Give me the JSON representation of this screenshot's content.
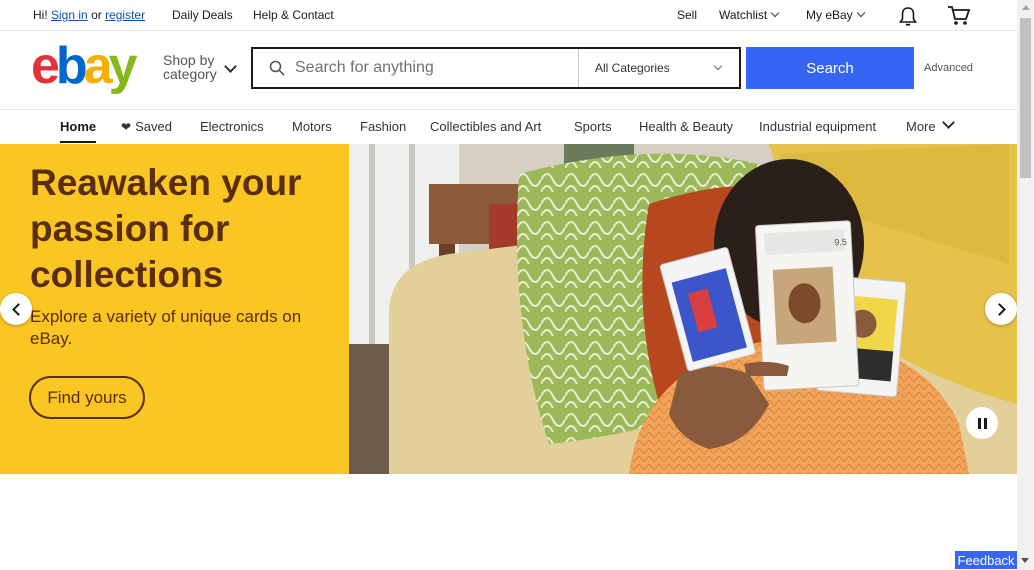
{
  "topbar": {
    "greeting": "Hi!",
    "sign_in": "Sign in",
    "or": "or",
    "register": "register",
    "daily_deals": "Daily Deals",
    "help": "Help & Contact",
    "sell": "Sell",
    "watchlist": "Watchlist",
    "my_ebay": "My eBay"
  },
  "header": {
    "logo": [
      "e",
      "b",
      "a",
      "y"
    ],
    "shop_by_line1": "Shop by",
    "shop_by_line2": "category",
    "search_placeholder": "Search for anything",
    "category_selected": "All Categories",
    "search_button": "Search",
    "advanced": "Advanced"
  },
  "nav": {
    "tabs": [
      {
        "label": "Home"
      },
      {
        "label": "Saved"
      },
      {
        "label": "Electronics"
      },
      {
        "label": "Motors"
      },
      {
        "label": "Fashion"
      },
      {
        "label": "Collectibles and Art"
      },
      {
        "label": "Sports"
      },
      {
        "label": "Health & Beauty"
      },
      {
        "label": "Industrial equipment"
      },
      {
        "label": "More"
      }
    ]
  },
  "hero": {
    "headline": "Reawaken your passion for collections",
    "subtext": "Explore a variety of unique cards on eBay.",
    "cta": "Find yours",
    "card_grade": "9.5"
  },
  "feedback": "Feedback",
  "colors": {
    "brand_blue": "#3665f3",
    "banner_yellow": "#f9c623",
    "banner_text": "#5a2d0c"
  },
  "icons": [
    "search-icon",
    "heart-icon",
    "bell-icon",
    "cart-icon",
    "chevron-down-icon",
    "chevron-left-icon",
    "chevron-right-icon",
    "pause-icon"
  ]
}
